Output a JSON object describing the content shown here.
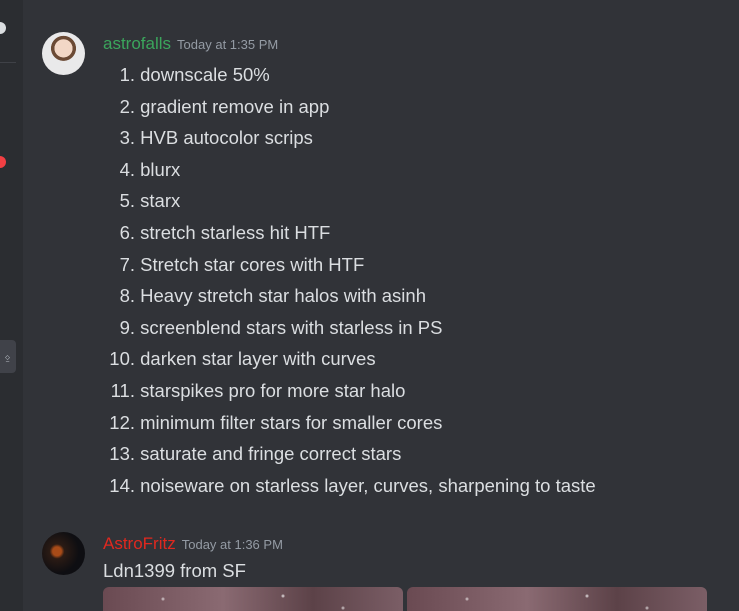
{
  "messages": [
    {
      "username": "astrofalls",
      "username_color": "#3ba55c",
      "timestamp": "Today at 1:35 PM",
      "steps": [
        {
          "num": "1.",
          "text": "downscale 50%"
        },
        {
          "num": "2.",
          "text": "gradient remove in app"
        },
        {
          "num": "3.",
          "text": "HVB autocolor scrips"
        },
        {
          "num": "4.",
          "text": "blurx"
        },
        {
          "num": "5.",
          "text": "starx"
        },
        {
          "num": "6.",
          "text": "stretch starless hit HTF"
        },
        {
          "num": "7.",
          "text": "Stretch star cores with HTF"
        },
        {
          "num": "8.",
          "text": "Heavy stretch star halos with asinh"
        },
        {
          "num": "9.",
          "text": "screenblend stars with starless in PS"
        },
        {
          "num": "10.",
          "text": "darken star layer with curves"
        },
        {
          "num": "11.",
          "text": "starspikes pro for more star halo"
        },
        {
          "num": "12.",
          "text": "minimum filter stars for smaller cores"
        },
        {
          "num": "13.",
          "text": "saturate and fringe correct stars"
        },
        {
          "num": "14.",
          "text": "noiseware on starless layer, curves, sharpening to taste"
        }
      ]
    },
    {
      "username": "AstroFritz",
      "username_color": "#e0281f",
      "timestamp": "Today at 1:36 PM",
      "text": "Ldn1399 from SF"
    }
  ],
  "colors": {
    "background": "#313338",
    "rail": "#2b2d31",
    "text": "#dbdee1",
    "muted": "#949ba4",
    "unread_badge": "#f23f43"
  },
  "icons": {
    "side_button": "add-member-icon"
  }
}
